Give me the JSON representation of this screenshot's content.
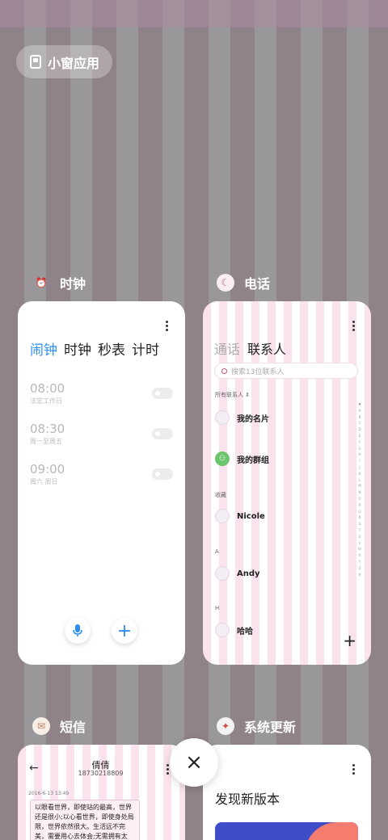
{
  "mini_window": {
    "label": "小窗应用"
  },
  "apps": {
    "clock": {
      "title": "时钟",
      "tabs": [
        "闹钟",
        "时钟",
        "秒表",
        "计时"
      ],
      "alarms": [
        {
          "time": "08:00",
          "repeat": "法定工作日"
        },
        {
          "time": "08:30",
          "repeat": "周一至周五"
        },
        {
          "time": "09:00",
          "repeat": "周六 周日"
        }
      ]
    },
    "phone": {
      "title": "电话",
      "tabs": [
        "通话",
        "联系人"
      ],
      "search_placeholder": "搜索13位联系人",
      "all_contacts_label": "所有联系人 ⇕",
      "my_card": "我的名片",
      "my_groups": "我的群组",
      "favorites_label": "收藏",
      "section_a": "A",
      "section_h": "H",
      "contacts": [
        "Nicole",
        "Andy",
        "哈哈"
      ],
      "alphabet": "♥ A B C D E F G H I J K L M N O P Q R S T U V W X Y Z #"
    },
    "sms": {
      "title": "短信",
      "contact_name": "倩倩",
      "contact_number": "18730218809",
      "timestamp": "2016-6-13 13:49",
      "message": "以眼看世界，即使站的最高，世界还是很小;以心看世界，即使身处局限，世界依然很大。生活远不完美，需要用心去体会;无需拥有太多，愿"
    },
    "update": {
      "title": "系统更新",
      "heading": "发现新版本"
    }
  },
  "close_icon": "×"
}
